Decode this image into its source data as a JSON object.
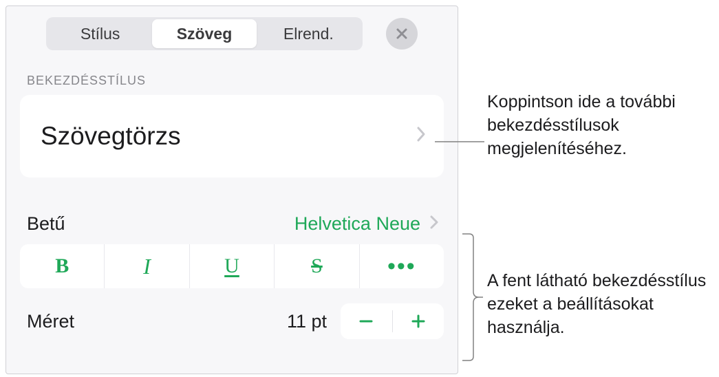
{
  "tabs": {
    "style": "Stílus",
    "text": "Szöveg",
    "layout": "Elrend."
  },
  "section": {
    "paragraph_style_label": "BEKEZDÉSSTÍLUS",
    "paragraph_style_value": "Szövegtörzs"
  },
  "font": {
    "label": "Betű",
    "value": "Helvetica Neue"
  },
  "style_buttons": {
    "bold": "B",
    "italic": "I",
    "underline": "U",
    "strike": "S",
    "more": "•••"
  },
  "size": {
    "label": "Méret",
    "value": "11 pt"
  },
  "callouts": {
    "c1": "Koppintson ide a további bekezdésstílusok megjelenítéséhez.",
    "c2": "A fent látható bekezdésstílus ezeket a beállításokat használja."
  }
}
